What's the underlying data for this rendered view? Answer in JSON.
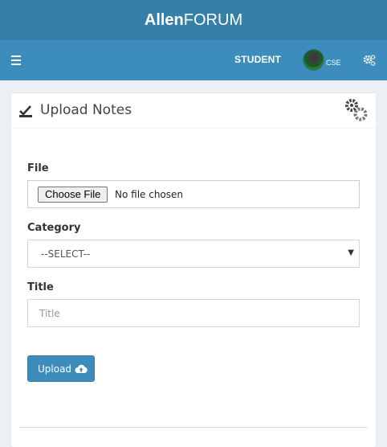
{
  "header": {
    "brand_bold": "Allen",
    "brand_rest": "FORUM"
  },
  "navbar": {
    "user_role": "STUDENT",
    "user_dept": "CSE",
    "menu_icon": "hamburger-icon",
    "settings_icon": "cogs-icon"
  },
  "box": {
    "title": "Upload Notes",
    "title_icon": "check-icon",
    "tool_icon": "gears-icon",
    "file": {
      "label": "File",
      "button": "Choose File",
      "status": "No file chosen"
    },
    "category": {
      "label": "Category",
      "selected": "--SELECT--"
    },
    "title_field": {
      "label": "Title",
      "placeholder": "Title"
    },
    "upload_button": "Upload",
    "upload_icon": "cloud-upload-icon"
  },
  "colors": {
    "logo_bg": "#367fa9",
    "navbar_bg": "#3c8dbc",
    "button_bg": "#3c8dbc",
    "page_bg": "#ecf0f5"
  }
}
